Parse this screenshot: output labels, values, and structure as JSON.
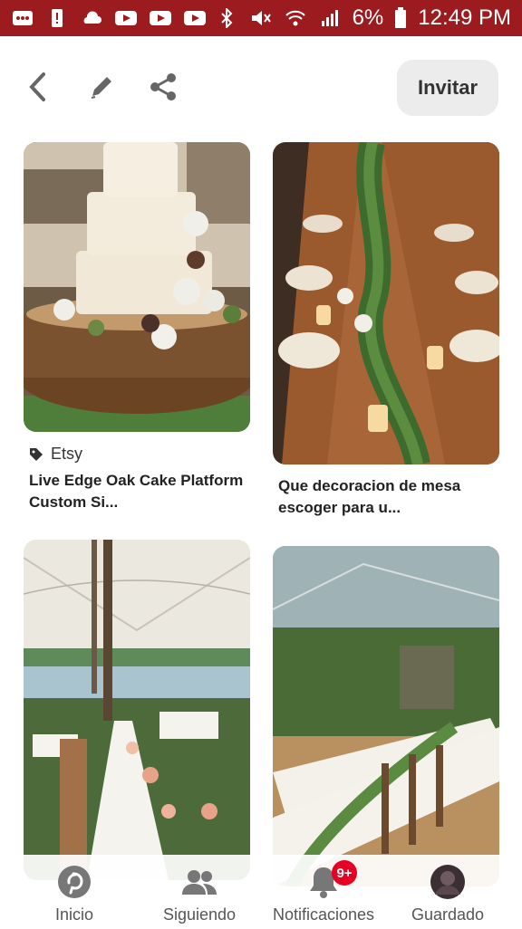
{
  "status_bar": {
    "battery": "6%",
    "time": "12:49 PM",
    "bg": "#9b1b1f"
  },
  "top_bar": {
    "invite_label": "Invitar"
  },
  "pins": [
    {
      "source": "Etsy",
      "title": "Live Edge Oak Cake Platform Custom Si..."
    },
    {
      "title": "Que decoracion de mesa escoger para u..."
    }
  ],
  "bottom_nav": {
    "items": [
      {
        "label": "Inicio",
        "icon": "pinterest-icon"
      },
      {
        "label": "Siguiendo",
        "icon": "people-icon"
      },
      {
        "label": "Notificaciones",
        "icon": "bell-icon",
        "badge": "9+"
      },
      {
        "label": "Guardado",
        "icon": "avatar"
      }
    ]
  },
  "colors": {
    "accent": "#e60023",
    "status": "#9b1b1f"
  }
}
